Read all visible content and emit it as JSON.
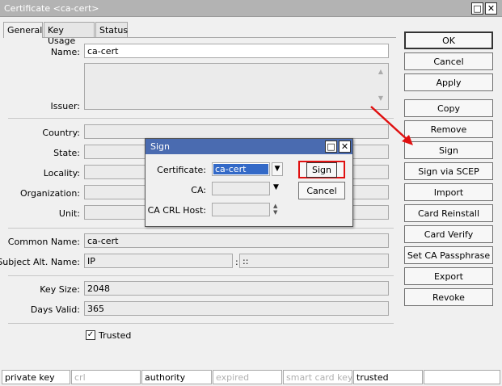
{
  "window": {
    "title": "Certificate <ca-cert>",
    "maximize_glyph": "□",
    "close_glyph": "✕"
  },
  "tabs": [
    {
      "label": "General",
      "active": true
    },
    {
      "label": "Key Usage",
      "active": false
    },
    {
      "label": "Status",
      "active": false
    }
  ],
  "form": {
    "name_label": "Name:",
    "name_value": "ca-cert",
    "issuer_label": "Issuer:",
    "issuer_value": "",
    "country_label": "Country:",
    "state_label": "State:",
    "locality_label": "Locality:",
    "organization_label": "Organization:",
    "unit_label": "Unit:",
    "common_name_label": "Common Name:",
    "common_name_value": "ca-cert",
    "subject_alt_label": "Subject Alt. Name:",
    "subject_alt_type": "IP",
    "subject_alt_sep": ":",
    "subject_alt_value": "::",
    "key_size_label": "Key Size:",
    "key_size_value": "2048",
    "days_valid_label": "Days Valid:",
    "days_valid_value": "365",
    "trusted_label": "Trusted",
    "trusted_checked": true
  },
  "buttons": {
    "ok": "OK",
    "cancel": "Cancel",
    "apply": "Apply",
    "copy": "Copy",
    "remove": "Remove",
    "sign": "Sign",
    "sign_via_scep": "Sign via SCEP",
    "import": "Import",
    "card_reinstall": "Card Reinstall",
    "card_verify": "Card Verify",
    "set_ca_passphrase": "Set CA Passphrase",
    "export": "Export",
    "revoke": "Revoke"
  },
  "status_bar": [
    {
      "text": "private key",
      "active": true
    },
    {
      "text": "crl",
      "active": false
    },
    {
      "text": "authority",
      "active": true
    },
    {
      "text": "expired",
      "active": false
    },
    {
      "text": "smart card key",
      "active": false
    },
    {
      "text": "trusted",
      "active": true
    },
    {
      "text": "",
      "active": true
    }
  ],
  "sign_dialog": {
    "title": "Sign",
    "certificate_label": "Certificate:",
    "certificate_value": "ca-cert",
    "ca_label": "CA:",
    "ca_value": "",
    "crl_host_label": "CA CRL Host:",
    "crl_host_value": "",
    "sign_button": "Sign",
    "cancel_button": "Cancel"
  },
  "colors": {
    "titlebar": "#b3b3b3",
    "dialog_titlebar": "#4a6bb0",
    "selection": "#3369c7",
    "highlight_red": "#e01010"
  }
}
